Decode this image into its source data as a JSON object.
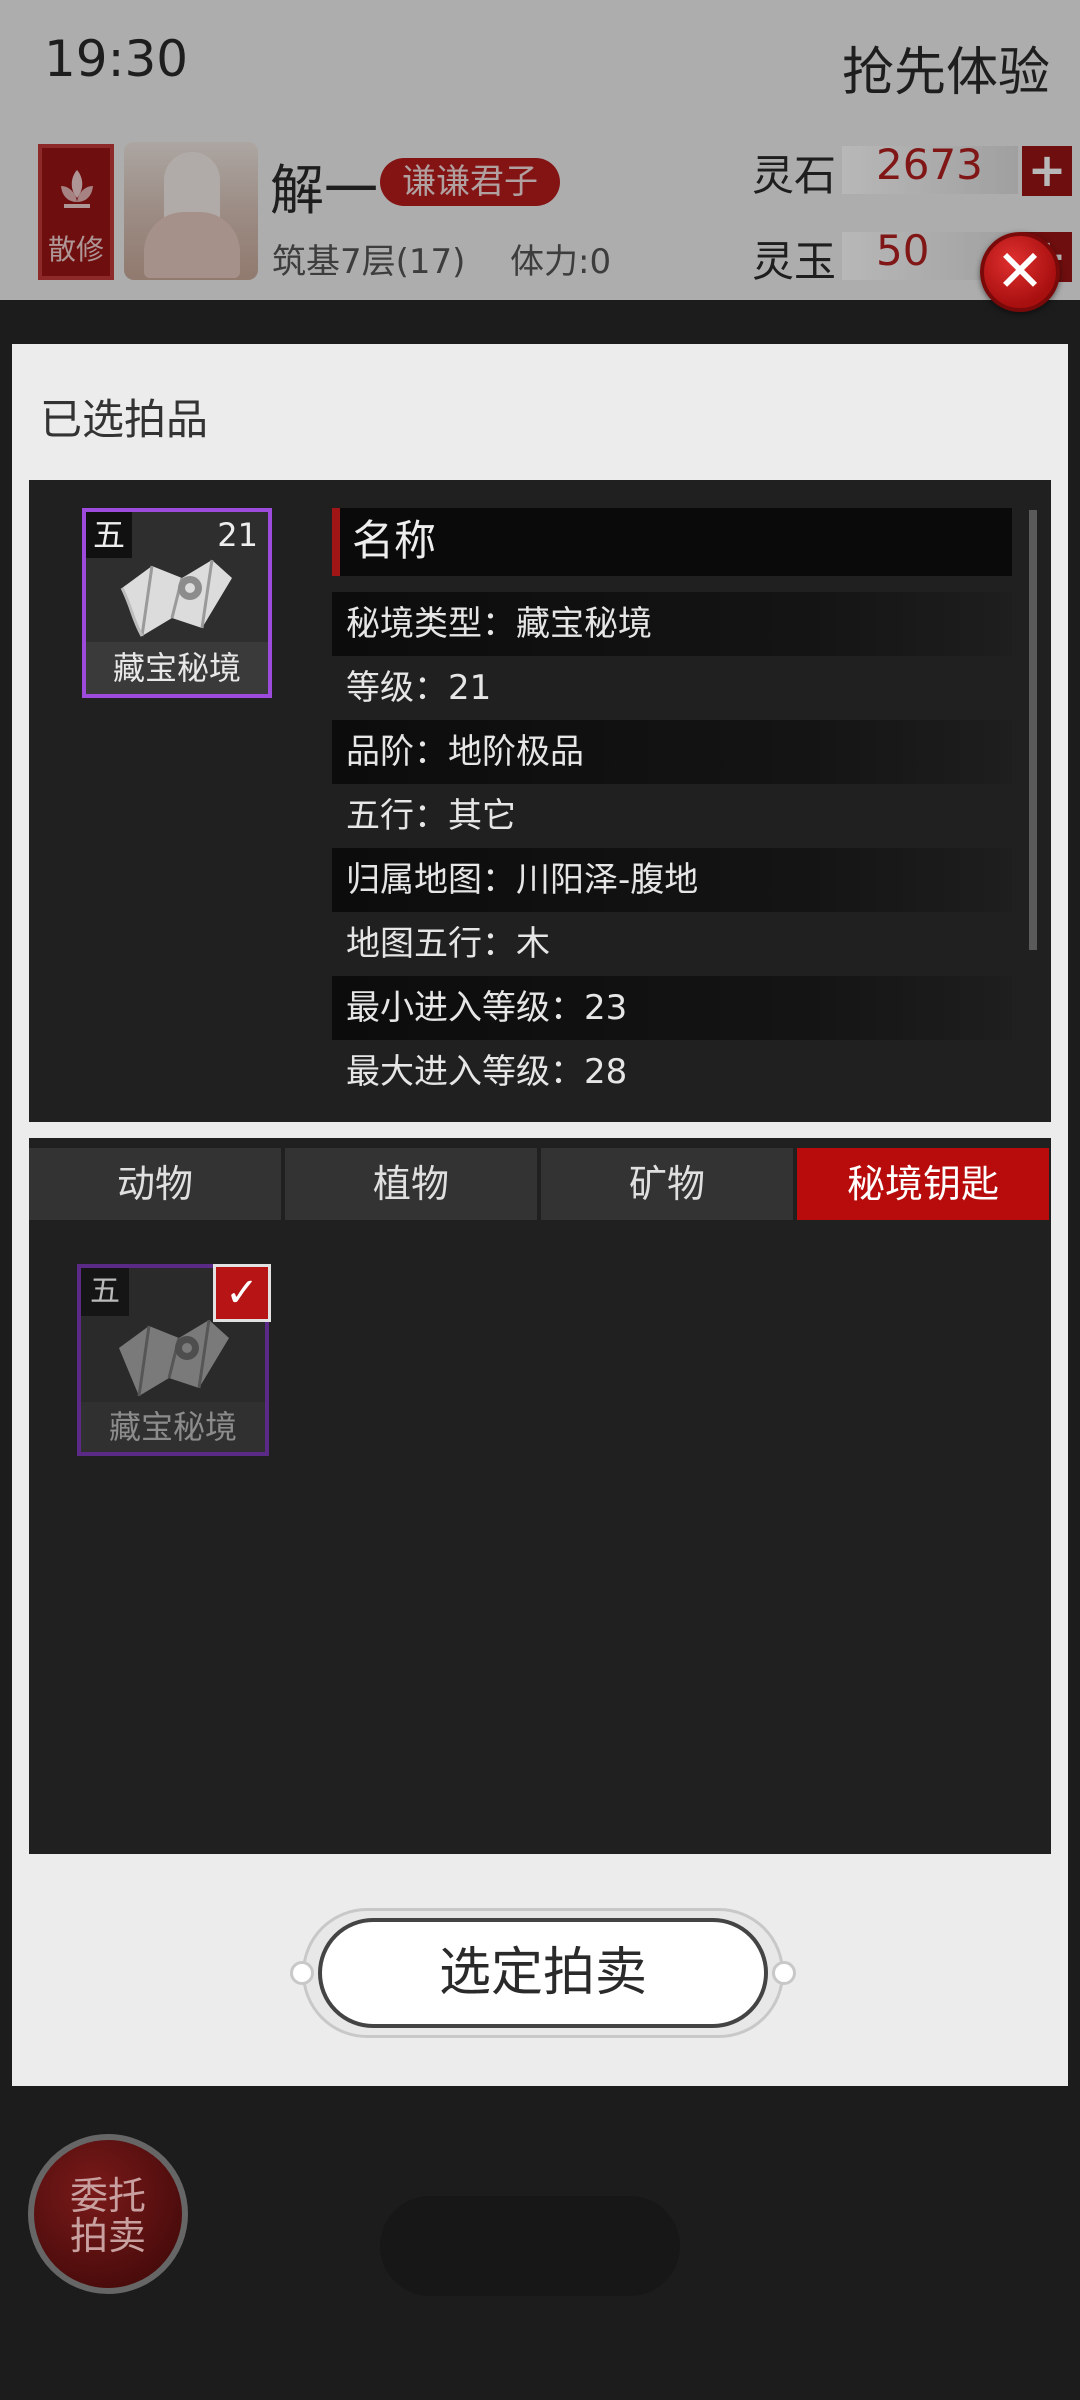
{
  "status": {
    "time": "19:30",
    "early_access": "抢先体验"
  },
  "player": {
    "sect": "散修",
    "name": "解一",
    "title": "谦谦君子",
    "level": "筑基7层(17)",
    "stamina": "体力:0"
  },
  "resources": [
    {
      "label": "灵石",
      "value": "2673"
    },
    {
      "label": "灵玉",
      "value": "50"
    }
  ],
  "modal": {
    "title": "已选拍品",
    "selected_item": {
      "grade": "五",
      "level": "21",
      "name": "藏宝秘境"
    },
    "details": {
      "header": "名称",
      "rows": [
        "秘境类型：藏宝秘境",
        "等级：21",
        "品阶：地阶极品",
        "五行：其它",
        "归属地图：川阳泽-腹地",
        "地图五行：木",
        "最小进入等级：23",
        "最大进入等级：28"
      ]
    },
    "tabs": [
      "动物",
      "植物",
      "矿物",
      "秘境钥匙"
    ],
    "active_tab": "秘境钥匙",
    "list_items": [
      {
        "grade": "五",
        "name": "藏宝秘境",
        "selected": true
      }
    ],
    "confirm_label": "选定拍卖"
  },
  "consign_label_line1": "委托",
  "consign_label_line2": "拍卖",
  "colors": {
    "accent_red": "#b80c0c",
    "rare_purple": "#9c4bdc"
  }
}
